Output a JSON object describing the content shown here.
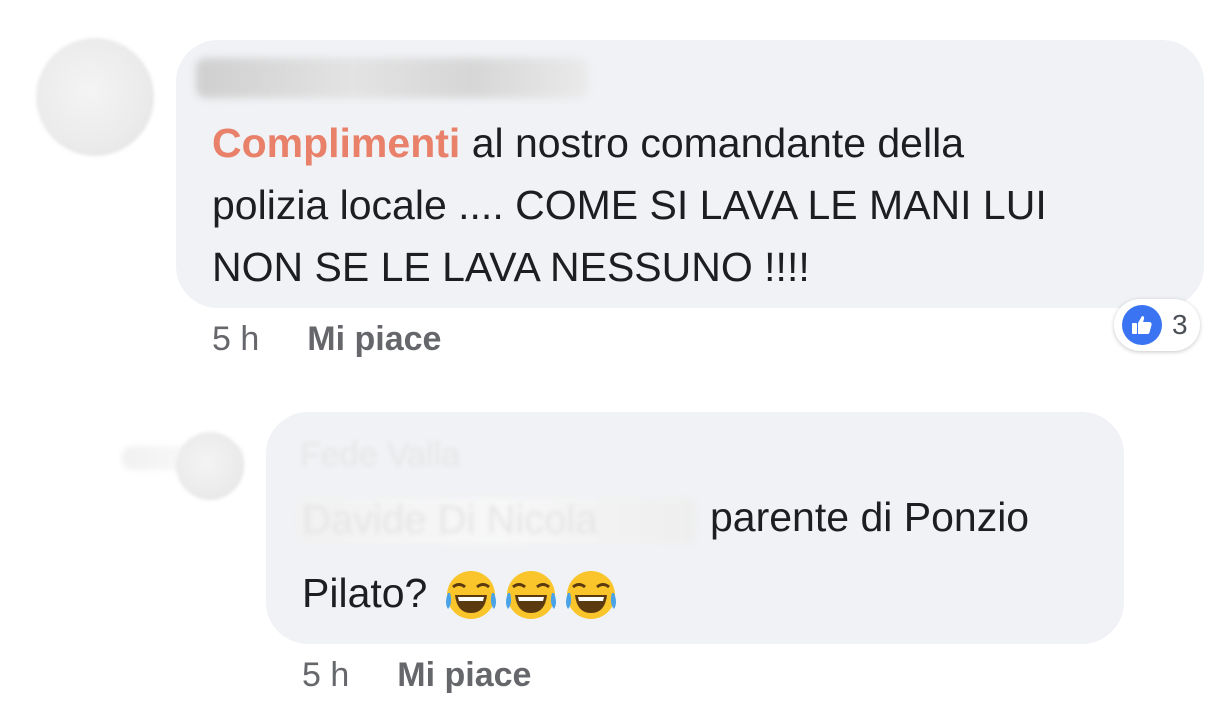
{
  "comment": {
    "mention": "Complimenti",
    "text_line1": " al nostro comandante della",
    "text_line2": "polizia locale .... COME SI LAVA LE MANI LUI",
    "text_line3": "NON SE LE LAVA NESSUNO !!!!",
    "time": "5 h",
    "like_label": "Mi piace",
    "reaction_count": "3",
    "reaction_icon": "thumbs-up-icon",
    "accent_color": "#e8806a",
    "reaction_color": "#3b74f2"
  },
  "reply": {
    "author_ghost": "Fede Valla",
    "mention_ghost": "Davide Di Nicola",
    "text_line1": "parente di Ponzio",
    "text_line2": "Pilato?",
    "emojis": [
      "laughing-crying-emoji",
      "laughing-crying-emoji",
      "laughing-crying-emoji"
    ],
    "time": "5 h",
    "like_label": "Mi piace"
  }
}
